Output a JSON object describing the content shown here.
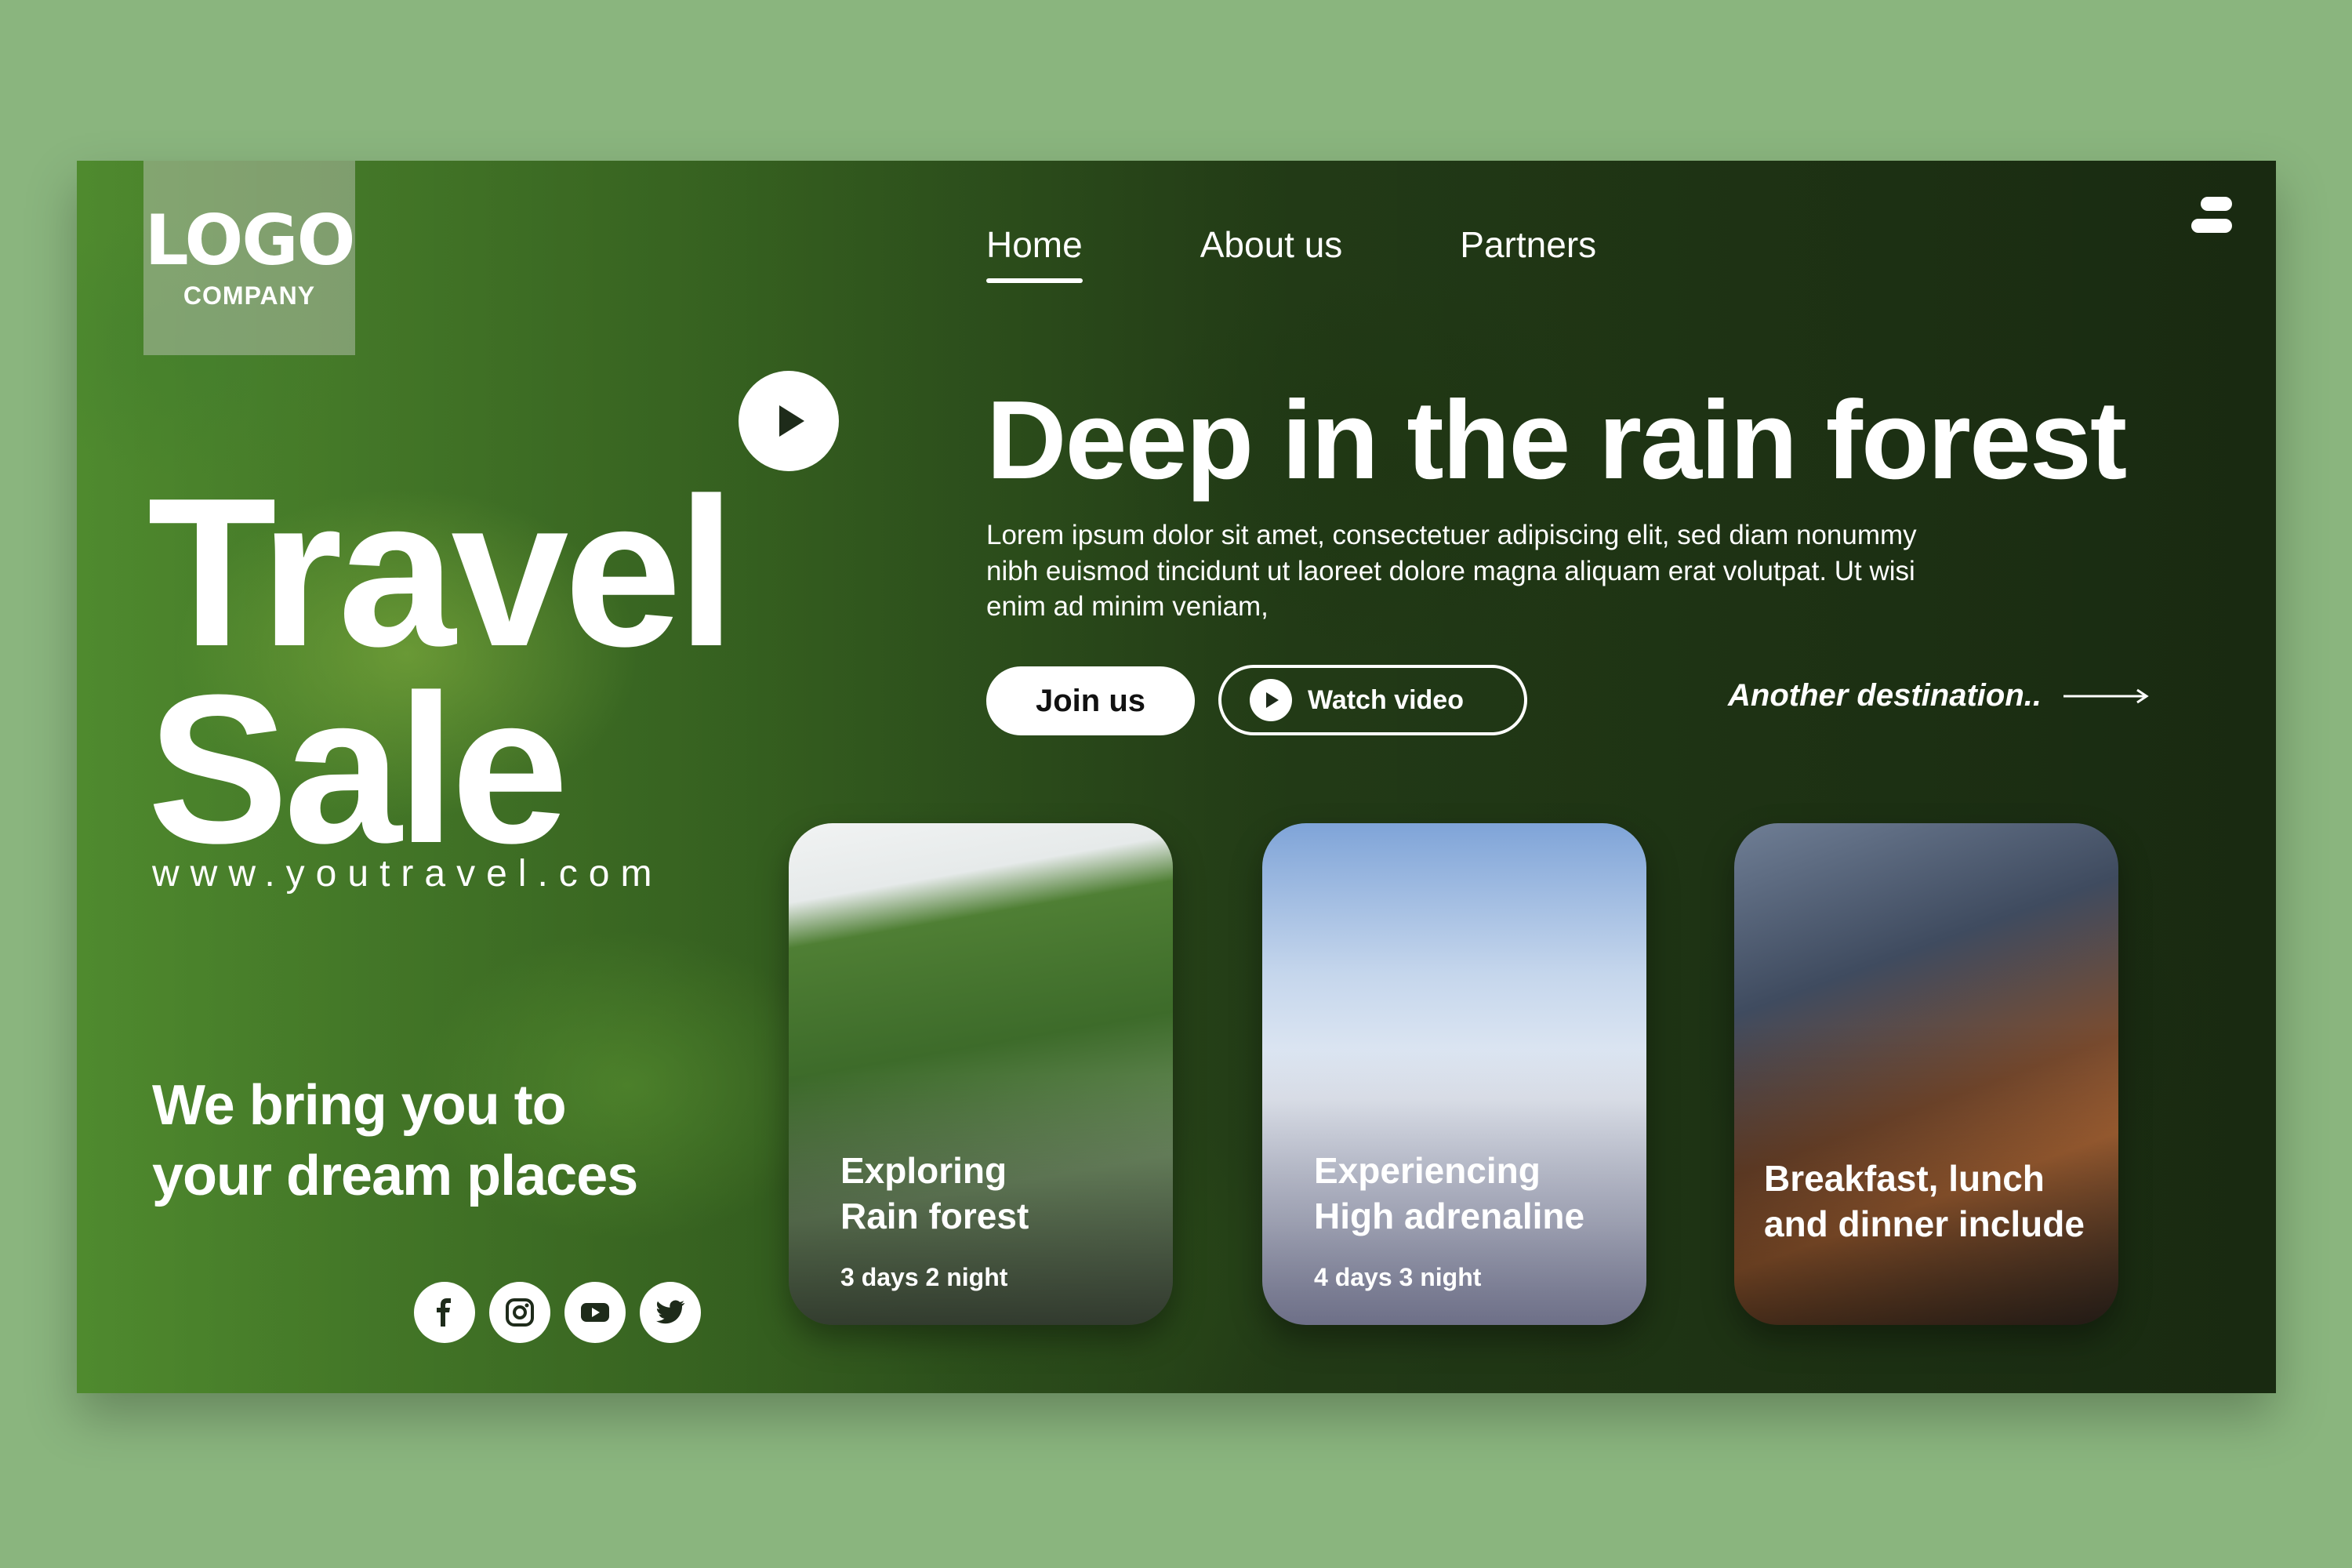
{
  "logo": {
    "main": "LOGO",
    "sub": "COMPANY"
  },
  "nav": {
    "items": [
      "Home",
      "About us",
      "Partners"
    ],
    "active": "Home"
  },
  "hero": {
    "title_line1": "Travel",
    "title_line2": "Sale",
    "website": "www.youtravel.com",
    "tagline_line1": "We bring you to",
    "tagline_line2": "your dream places",
    "headline": "Deep in the rain forest",
    "description": "Lorem ipsum dolor sit amet, consectetuer adipiscing elit, sed diam nonummy nibh euismod tincidunt ut laoreet dolore magna aliquam erat volutpat. Ut wisi enim ad minim veniam,",
    "join_label": "Join us",
    "watch_label": "Watch video",
    "another_label": "Another destination.."
  },
  "social": [
    "facebook-icon",
    "instagram-icon",
    "youtube-icon",
    "twitter-icon"
  ],
  "cards": [
    {
      "line1": "Exploring",
      "line2": "Rain forest",
      "sub": "3 days 2 night"
    },
    {
      "line1": "Experiencing",
      "line2": "High adrenaline",
      "sub": "4 days 3 night"
    },
    {
      "line1": "Breakfast, lunch",
      "line2": "and dinner include",
      "sub": ""
    }
  ],
  "colors": {
    "page_background": "#8ab57e",
    "accent_white": "#ffffff"
  }
}
